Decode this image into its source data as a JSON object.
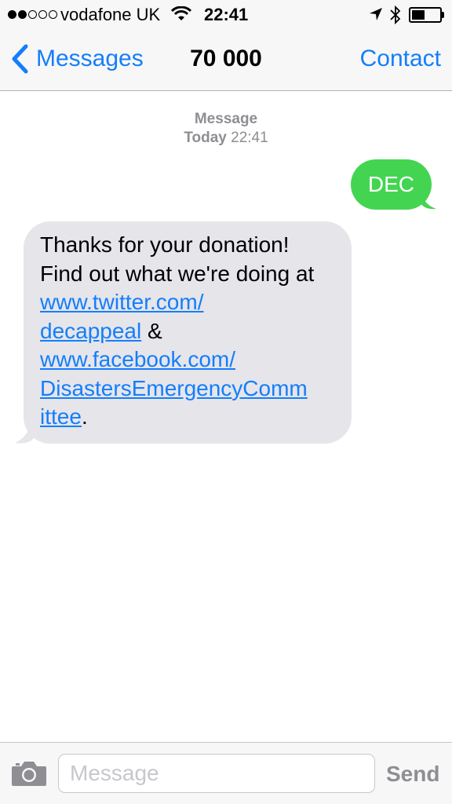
{
  "status_bar": {
    "signal_filled": 2,
    "signal_total": 5,
    "carrier": "vodafone UK",
    "time": "22:41",
    "icons": [
      "wifi-icon",
      "location-arrow-icon",
      "bluetooth-icon",
      "battery-icon"
    ],
    "battery_level": 0.42
  },
  "nav": {
    "back_label": "Messages",
    "title": "70 000",
    "contact_label": "Contact"
  },
  "conversation": {
    "header_label": "Message",
    "day": "Today",
    "time": "22:41",
    "sent_message": "DEC",
    "received": {
      "text_1": "Thanks for your donation! Find out what we're doing at",
      "link_1": "www.twitter.com/decappeal",
      "link_1_line_1": "www.twitter.com/",
      "link_1_line_2": "decappeal",
      "text_2": "&",
      "link_2": "www.facebook.com/DisastersEmergencyCommittee",
      "link_2_line_1": "www.facebook.com/",
      "link_2_line_2": "DisastersEmergencyComm",
      "link_2_line_3": "ittee",
      "text_3": "."
    }
  },
  "input_bar": {
    "placeholder": "Message",
    "send_label": "Send"
  },
  "colors": {
    "accent": "#147efb",
    "sent_bubble": "#43d551",
    "received_bubble": "#e5e5ea",
    "muted": "#8e8e93"
  }
}
